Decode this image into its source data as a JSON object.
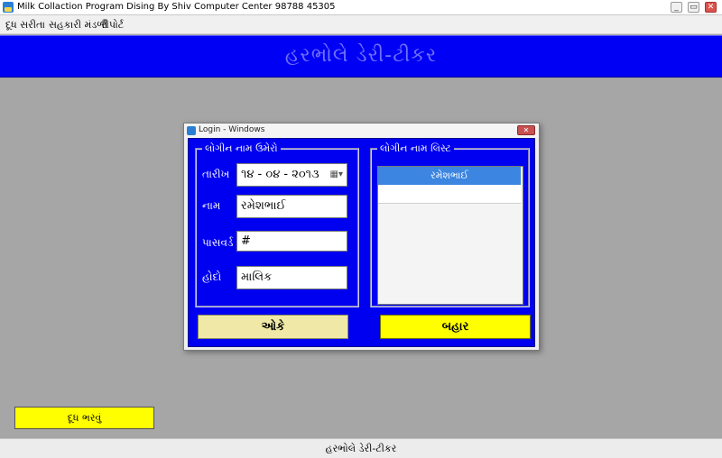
{
  "window": {
    "title": "Milk Collaction Program Dising By Shiv Computer Center 98788 45305",
    "minimize_glyph": "_",
    "maximize_glyph": "▭",
    "close_glyph": "✕"
  },
  "menu": {
    "items": [
      {
        "label": "દૂધ સરીતા"
      },
      {
        "label": "સહકારી મંડળી"
      },
      {
        "label": "રીપોર્ટ"
      }
    ]
  },
  "header": {
    "title": "હરભોલે ડેરી-ટીકર"
  },
  "dialog": {
    "title": "Login - Windows",
    "close_glyph": "✕",
    "login_group": {
      "legend": "લોગીન નામ ઉમેરો",
      "date_label": "તારીખ",
      "date_value": "૧૪ - ૦૪ - ૨૦૧૩",
      "name_label": "નામ",
      "name_value": "રમેશભાઈ",
      "password_label": "પાસવર્ડ",
      "password_value": "#",
      "designation_label": "હોદો",
      "designation_value": "માલિક"
    },
    "list_group": {
      "legend": "લોગીન નામ લિસ્ટ",
      "items": [
        "રમેશભાઈ"
      ]
    },
    "ok_label": "ઓકે",
    "exit_label": "બહાર"
  },
  "fill_milk_button": {
    "label": "દૂધ ભરવું"
  },
  "status_bar": {
    "text": "હરભોલે ડેરી-ટીકર"
  },
  "colors": {
    "header_bg": "#0000f5",
    "header_text": "#7070ff",
    "dialog_body": "#0000f0",
    "ok_button": "#f0e8a6",
    "exit_button": "#ffff00",
    "list_selection": "#3c85e0",
    "desktop_bg": "#a6a6a6"
  }
}
